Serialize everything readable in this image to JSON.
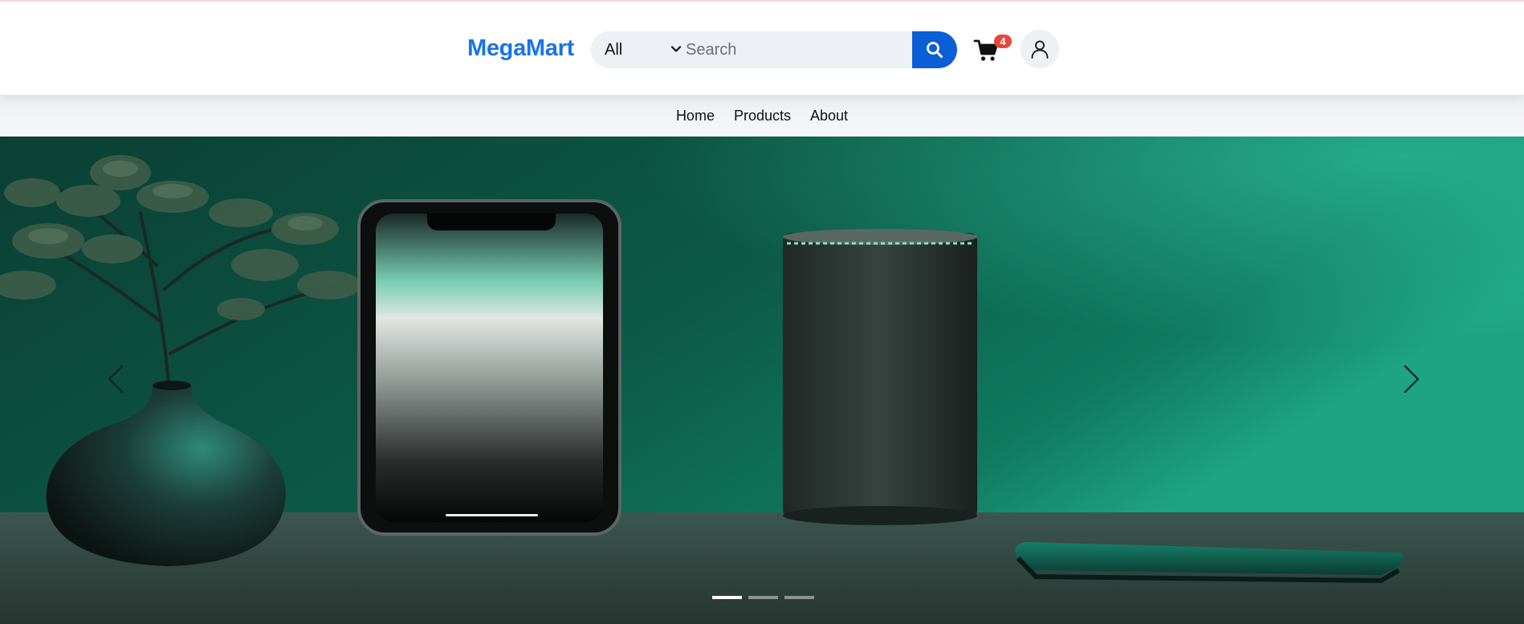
{
  "brand": {
    "name": "MegaMart",
    "color": "#1a73e8"
  },
  "search": {
    "category_selected": "All",
    "placeholder": "Search",
    "value": "",
    "button_icon": "search-icon",
    "button_color": "#0b5fd6"
  },
  "cart": {
    "icon": "cart-icon",
    "count": "4",
    "badge_color": "#e8453c"
  },
  "account": {
    "icon": "user-icon"
  },
  "nav": {
    "items": [
      {
        "label": "Home"
      },
      {
        "label": "Products"
      },
      {
        "label": "About"
      }
    ]
  },
  "hero": {
    "prev_icon": "chevron-left-icon",
    "next_icon": "chevron-right-icon",
    "slides_count": 3,
    "active_slide": 1,
    "theme_color": "#0e5c48"
  }
}
